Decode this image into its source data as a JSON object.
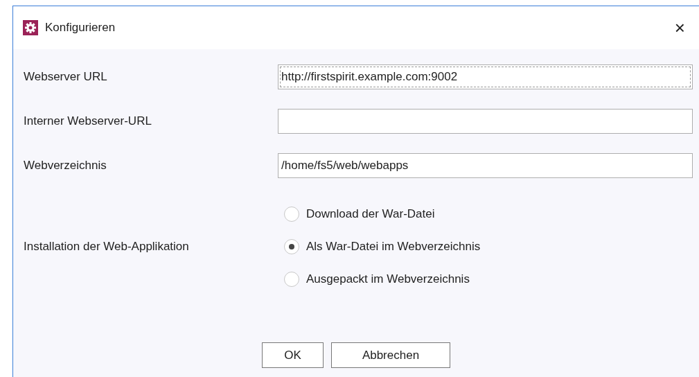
{
  "window": {
    "title": "Konfigurieren",
    "close": "×"
  },
  "fields": [
    {
      "label": "Webserver URL",
      "value": "http://firstspirit.example.com:9002",
      "focused": true
    },
    {
      "label": "Interner Webserver-URL",
      "focused": false
    },
    {
      "label": "Webverzeichnis",
      "value": "/home/fs5/web/webapps",
      "focused": false
    }
  ],
  "install": {
    "label": "Installation der Web-Applikation",
    "options": [
      {
        "label": "Download der War-Datei",
        "selected": false
      },
      {
        "label": "Als War-Datei im Webverzeichnis",
        "selected": true
      },
      {
        "label": "Ausgepackt im Webverzeichnis",
        "selected": false
      }
    ]
  },
  "buttons": [
    "OK",
    "Abbrechen"
  ]
}
